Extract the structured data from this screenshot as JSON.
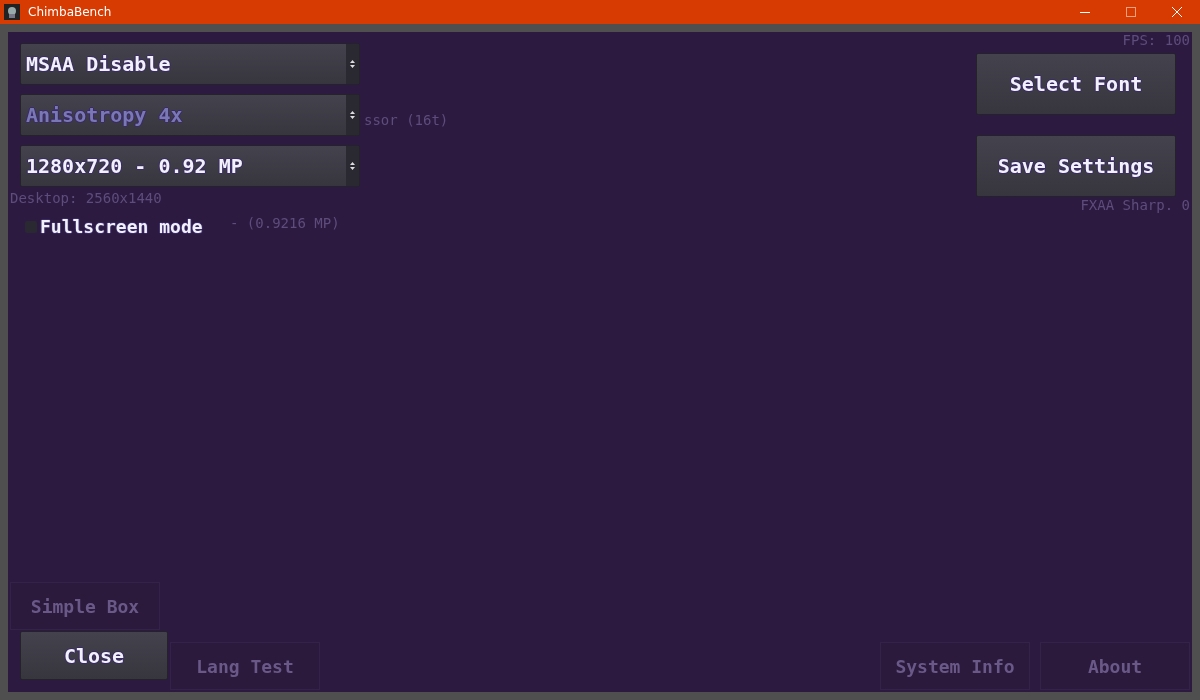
{
  "window": {
    "title": "ChimbaBench"
  },
  "overlay_left": [
    "ssor (16t)",
    "Desktop: 2560x1440",
    "- (0.9216 MP)"
  ],
  "overlay_right": [
    "FPS: 100",
    "FXAA Sharp. 0"
  ],
  "dropdowns": [
    {
      "value": "MSAA Disable",
      "disabled": false
    },
    {
      "value": "Anisotropy 4x",
      "disabled": true
    },
    {
      "value": "1280x720 - 0.92 MP",
      "disabled": false
    }
  ],
  "fullscreen": {
    "label": "Fullscreen mode",
    "checked": false
  },
  "right_buttons": [
    "Select Font",
    "Save Settings"
  ],
  "close_button": "Close",
  "faint_buttons": [
    "Simple Box",
    "Lang Test",
    "System Info",
    "About"
  ]
}
